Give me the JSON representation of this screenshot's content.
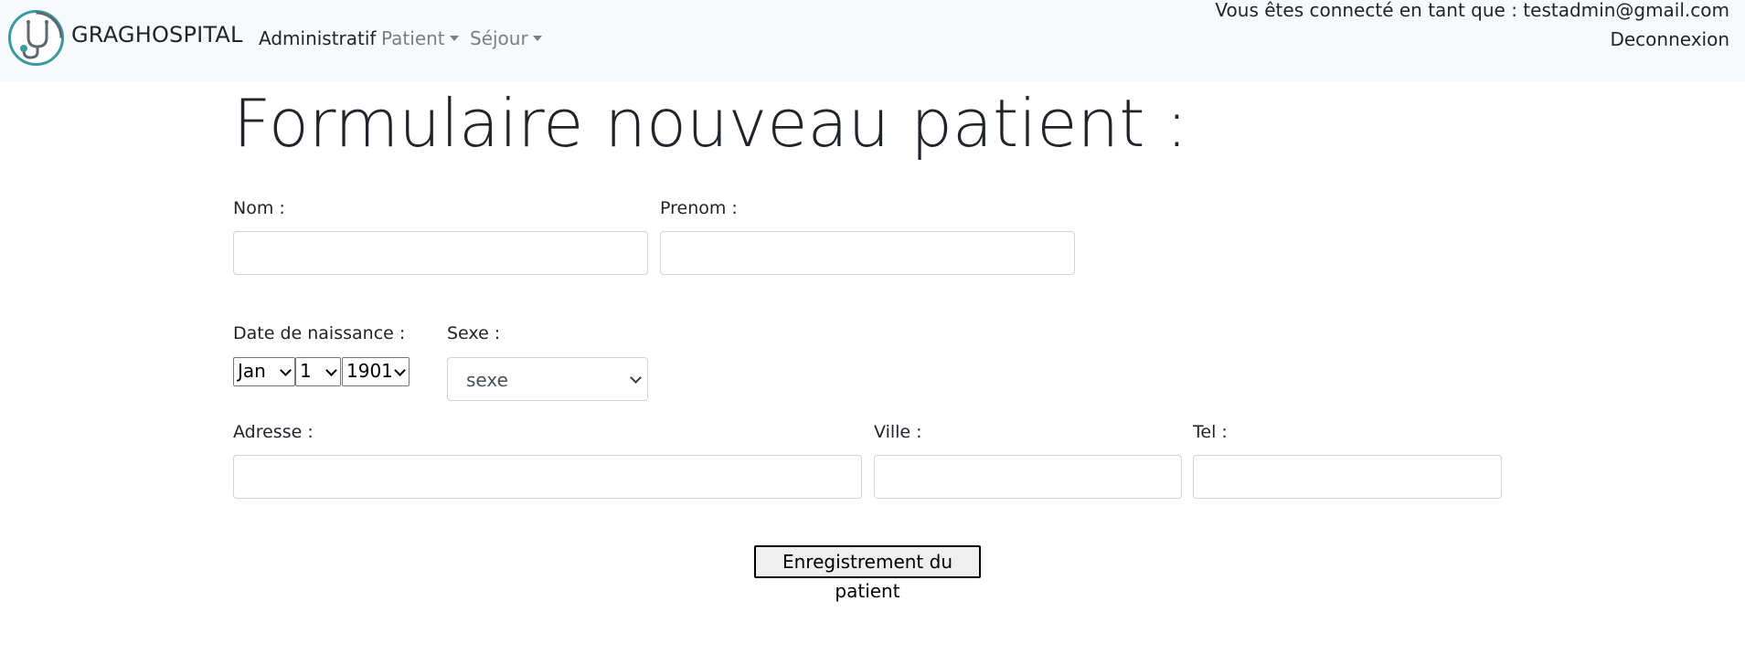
{
  "navbar": {
    "brand": "GRAGHOSPITAL",
    "links": {
      "administratif": "Administratif",
      "patient": "Patient",
      "sejour": "Séjour"
    },
    "user_text": "Vous êtes connecté en tant que : testadmin@gmail.com",
    "logout": "Deconnexion"
  },
  "form": {
    "title": "Formulaire nouveau patient :",
    "nom_label": "Nom :",
    "nom_value": "",
    "prenom_label": "Prenom :",
    "prenom_value": "",
    "dob_label": "Date de naissance :",
    "dob_month": "Jan",
    "dob_day": "1",
    "dob_year": "1901",
    "sexe_label": "Sexe :",
    "sexe_value": "sexe",
    "adresse_label": "Adresse :",
    "adresse_value": "",
    "ville_label": "Ville :",
    "ville_value": "",
    "tel_label": "Tel :",
    "tel_value": "",
    "submit": "Enregistrement du patient"
  },
  "colors": {
    "navbar_bg": "#f8f9fa",
    "logo_accent": "#3a9aa0",
    "muted_link": "#7a7f84"
  },
  "icons": {
    "logo": "stethoscope-logo-icon",
    "dropdown": "caret-down-icon"
  }
}
